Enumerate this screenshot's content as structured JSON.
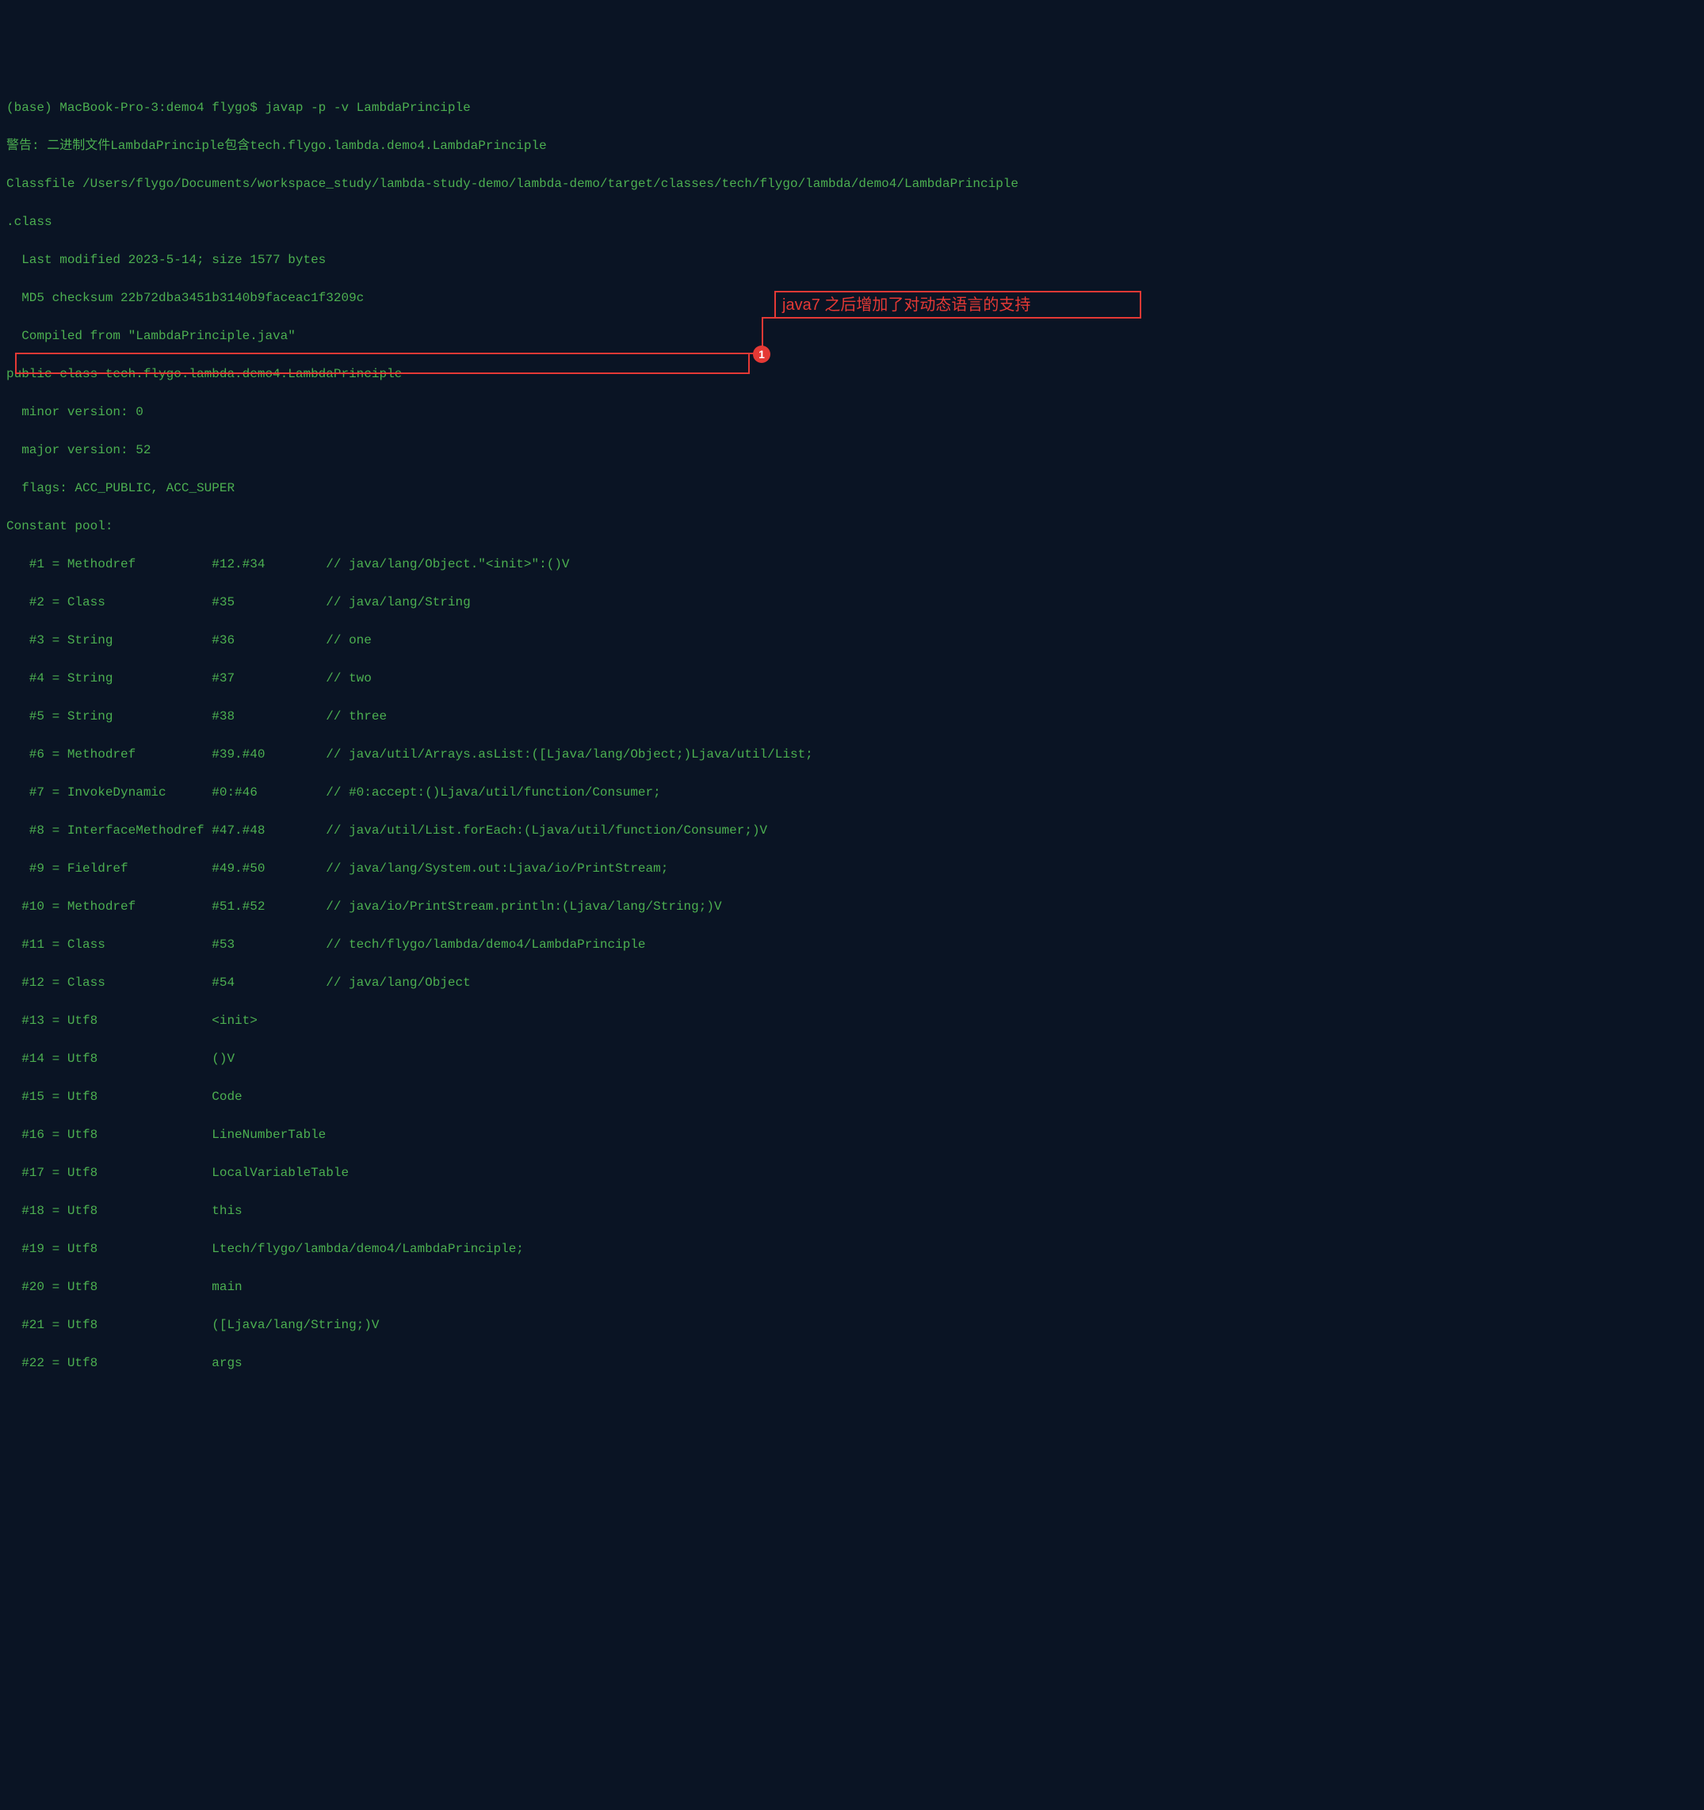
{
  "terminal": {
    "lines": [
      "(base) MacBook-Pro-3:demo4 flygo$ javap -p -v LambdaPrinciple",
      "警告: 二进制文件LambdaPrinciple包含tech.flygo.lambda.demo4.LambdaPrinciple",
      "Classfile /Users/flygo/Documents/workspace_study/lambda-study-demo/lambda-demo/target/classes/tech/flygo/lambda/demo4/LambdaPrinciple",
      ".class",
      "  Last modified 2023-5-14; size 1577 bytes",
      "  MD5 checksum 22b72dba3451b3140b9faceac1f3209c",
      "  Compiled from \"LambdaPrinciple.java\"",
      "public class tech.flygo.lambda.demo4.LambdaPrinciple",
      "  minor version: 0",
      "  major version: 52",
      "  flags: ACC_PUBLIC, ACC_SUPER",
      "Constant pool:",
      "   #1 = Methodref          #12.#34        // java/lang/Object.\"<init>\":()V",
      "   #2 = Class              #35            // java/lang/String",
      "   #3 = String             #36            // one",
      "   #4 = String             #37            // two",
      "   #5 = String             #38            // three",
      "   #6 = Methodref          #39.#40        // java/util/Arrays.asList:([Ljava/lang/Object;)Ljava/util/List;",
      "   #7 = InvokeDynamic      #0:#46         // #0:accept:()Ljava/util/function/Consumer;",
      "   #8 = InterfaceMethodref #47.#48        // java/util/List.forEach:(Ljava/util/function/Consumer;)V",
      "   #9 = Fieldref           #49.#50        // java/lang/System.out:Ljava/io/PrintStream;",
      "  #10 = Methodref          #51.#52        // java/io/PrintStream.println:(Ljava/lang/String;)V",
      "  #11 = Class              #53            // tech/flygo/lambda/demo4/LambdaPrinciple",
      "  #12 = Class              #54            // java/lang/Object",
      "  #13 = Utf8               <init>",
      "  #14 = Utf8               ()V",
      "  #15 = Utf8               Code",
      "  #16 = Utf8               LineNumberTable",
      "  #17 = Utf8               LocalVariableTable",
      "  #18 = Utf8               this",
      "  #19 = Utf8               Ltech/flygo/lambda/demo4/LambdaPrinciple;",
      "  #20 = Utf8               main",
      "  #21 = Utf8               ([Ljava/lang/String;)V",
      "  #22 = Utf8               args"
    ]
  },
  "annotation": {
    "text": "java7 之后增加了对动态语言的支持",
    "badge_number": "1"
  }
}
